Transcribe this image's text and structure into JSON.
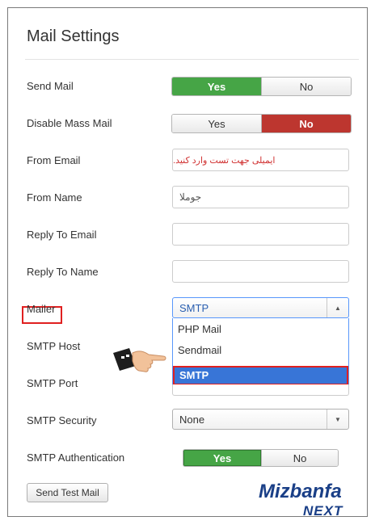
{
  "title": "Mail Settings",
  "fields": {
    "send_mail": {
      "label": "Send Mail",
      "yes": "Yes",
      "no": "No",
      "value": "Yes"
    },
    "disable_mass_mail": {
      "label": "Disable Mass Mail",
      "yes": "Yes",
      "no": "No",
      "value": "No"
    },
    "from_email": {
      "label": "From Email",
      "value": "ایمیلی جهت تست وارد کنید."
    },
    "from_name": {
      "label": "From Name",
      "value": "جوملا"
    },
    "reply_to_email": {
      "label": "Reply To Email",
      "value": ""
    },
    "reply_to_name": {
      "label": "Reply To Name",
      "value": ""
    },
    "mailer": {
      "label": "Mailer",
      "value": "SMTP",
      "options": [
        "PHP Mail",
        "Sendmail",
        "SMTP"
      ],
      "highlighted": "SMTP"
    },
    "smtp_host": {
      "label": "SMTP Host"
    },
    "smtp_port": {
      "label": "SMTP Port"
    },
    "smtp_security": {
      "label": "SMTP Security",
      "value": "None"
    },
    "smtp_auth": {
      "label": "SMTP Authentication",
      "yes": "Yes",
      "no": "No",
      "value": "Yes"
    }
  },
  "buttons": {
    "send_test_mail": "Send Test Mail"
  },
  "watermark": {
    "line1": "Mizbanfa",
    "line2": "NEXT"
  },
  "colors": {
    "green": "#46a546",
    "red": "#bd362f",
    "select_blue": "#3875d7",
    "highlight_red": "#e02020",
    "brand_blue": "#1a3f87"
  }
}
